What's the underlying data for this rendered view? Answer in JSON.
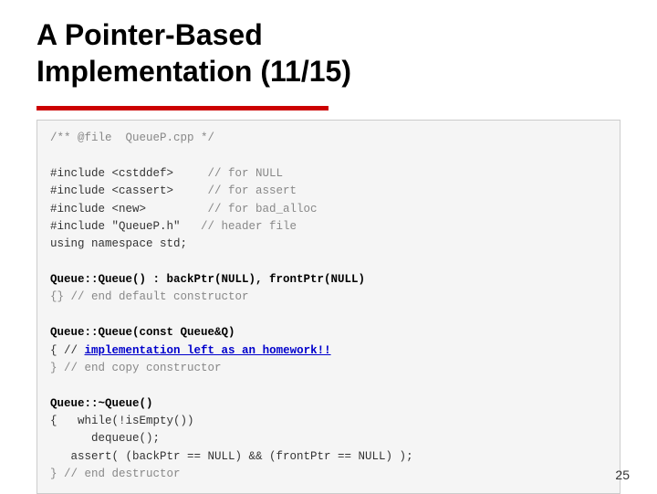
{
  "title": {
    "line1": "A Pointer-Based",
    "line2": "Implementation (11/15)"
  },
  "slide_number": "25",
  "code": {
    "file_comment": "/** @file  QueueP.cpp */",
    "includes": [
      {
        "inc": "#include <cstddef>",
        "comment": "// for NULL"
      },
      {
        "inc": "#include <cassert>",
        "comment": "// for assert"
      },
      {
        "inc": "#include <new>",
        "comment": "// for bad_alloc"
      },
      {
        "inc": "#include \"QueueP.h\"",
        "comment": "// header file"
      }
    ],
    "using": "using namespace std;",
    "section1_bold": "Queue::Queue() : backPtr(NULL), frontPtr(NULL)",
    "section1_line2": "{} // end default constructor",
    "section2_bold": "Queue::Queue(const Queue&Q)",
    "section2_line2": "{ // ",
    "section2_link": "implementation left as an homework!!",
    "section2_line3": "} // end copy constructor",
    "section3_bold": "Queue::~Queue()",
    "section3_line2": "{   while(!isEmpty())",
    "section3_line3": "      dequeue();",
    "section3_line4": "   assert( (backPtr == NULL) && (frontPtr == NULL) );",
    "section3_line5": "} // end destructor"
  }
}
